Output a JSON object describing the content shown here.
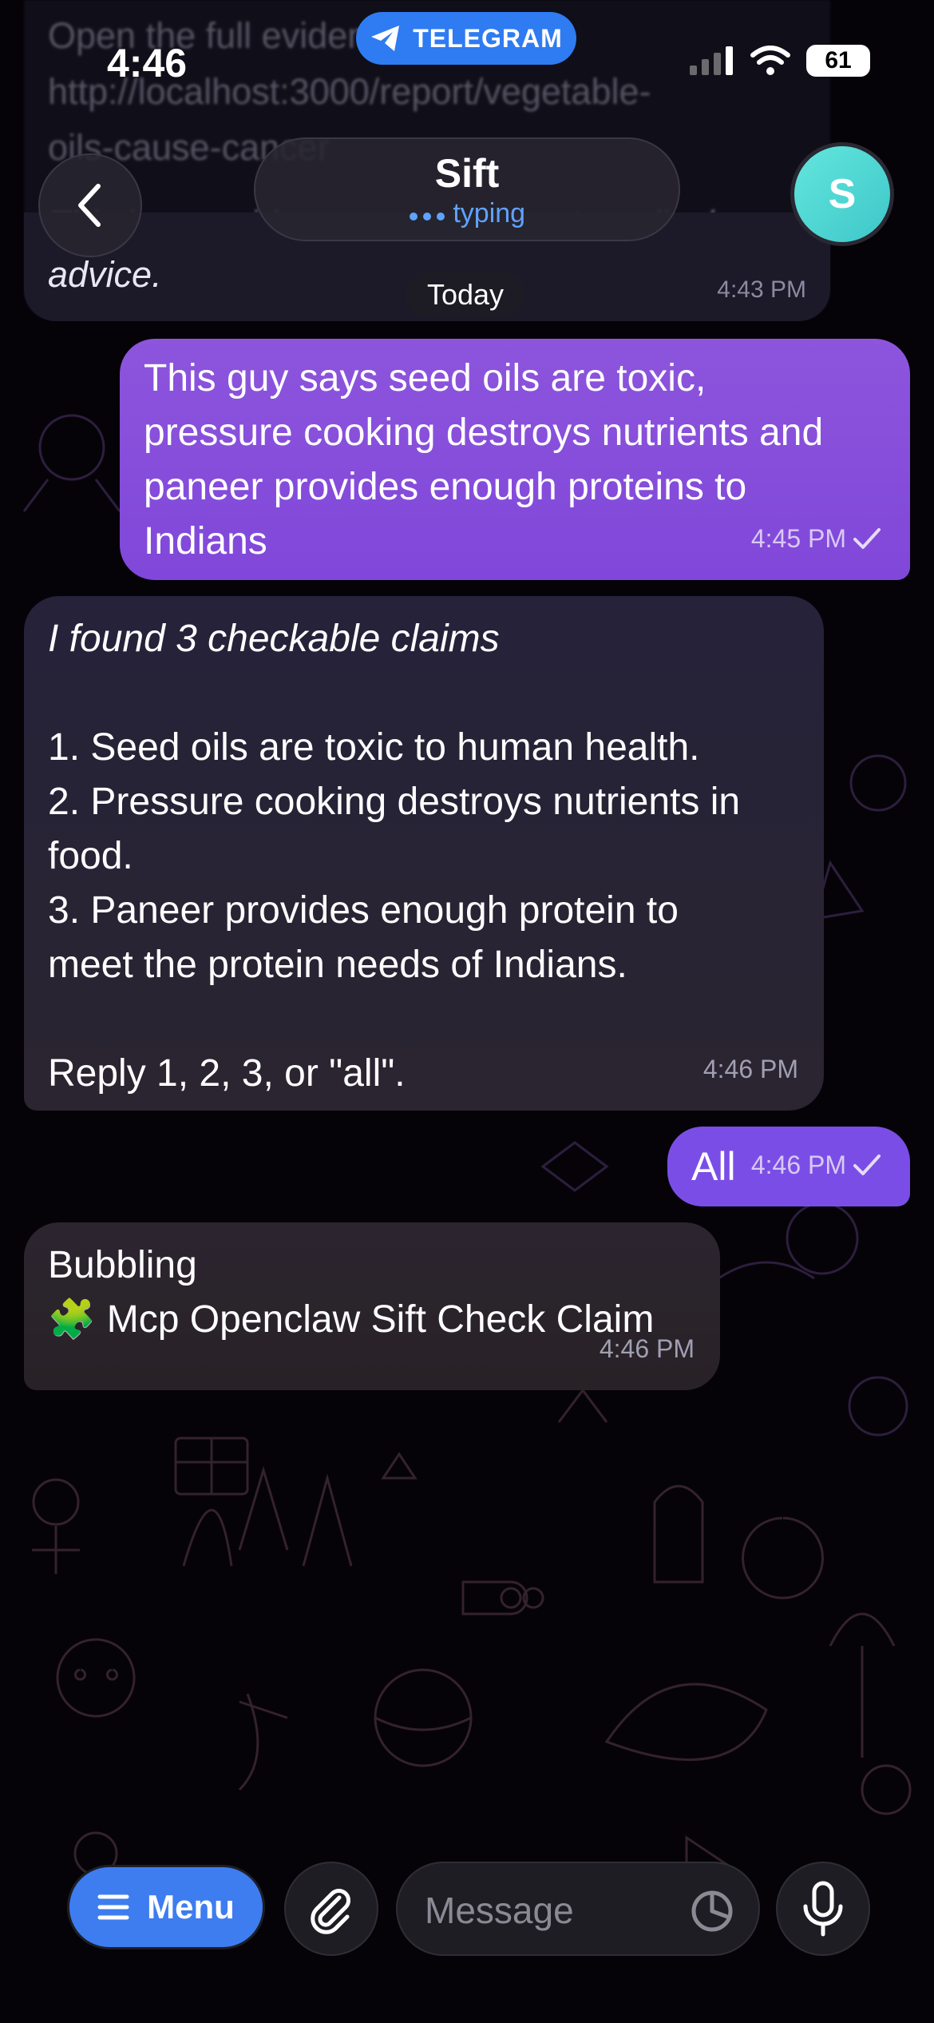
{
  "status_bar": {
    "time": "4:46",
    "app_pill": "TELEGRAM",
    "battery": "61"
  },
  "header": {
    "title": "Sift",
    "status": "typing",
    "avatar_letter": "S"
  },
  "previous_message": {
    "lines": [
      "Open the full evidence here:",
      "http://localhost:3000/report/vegetable-",
      "oils-cause-cancer",
      "This is an evidence summary, not medical"
    ],
    "last_line": "advice.",
    "time": "4:43 PM"
  },
  "date_separator": "Today",
  "messages": [
    {
      "direction": "outgoing",
      "lines": [
        "This guy says seed oils are toxic,",
        "pressure cooking destroys nutrients and",
        "paneer provides enough proteins to",
        "Indians"
      ],
      "time": "4:45 PM"
    },
    {
      "direction": "incoming",
      "intro": "I found 3 checkable claims",
      "lines": [
        "1. Seed oils are toxic to human health.",
        "2. Pressure cooking destroys nutrients in",
        "food.",
        "3. Paneer provides enough protein to",
        "meet the protein needs of Indians."
      ],
      "footer": "Reply 1, 2, 3, or \"all\".",
      "time": "4:46 PM"
    },
    {
      "direction": "outgoing",
      "text": "All",
      "time": "4:46 PM"
    },
    {
      "direction": "incoming",
      "line1": "Bubbling",
      "tool_emoji": "🧩",
      "tool_name": "Mcp Openclaw Sift Check Claim",
      "time": "4:46 PM"
    }
  ],
  "composer": {
    "menu_label": "Menu",
    "placeholder": "Message"
  },
  "colors": {
    "accent_blue": "#3d7df0",
    "outgoing_bubble": "#8b4fd9",
    "incoming_bubble": "#25223a",
    "avatar": "#4fd6d2"
  }
}
